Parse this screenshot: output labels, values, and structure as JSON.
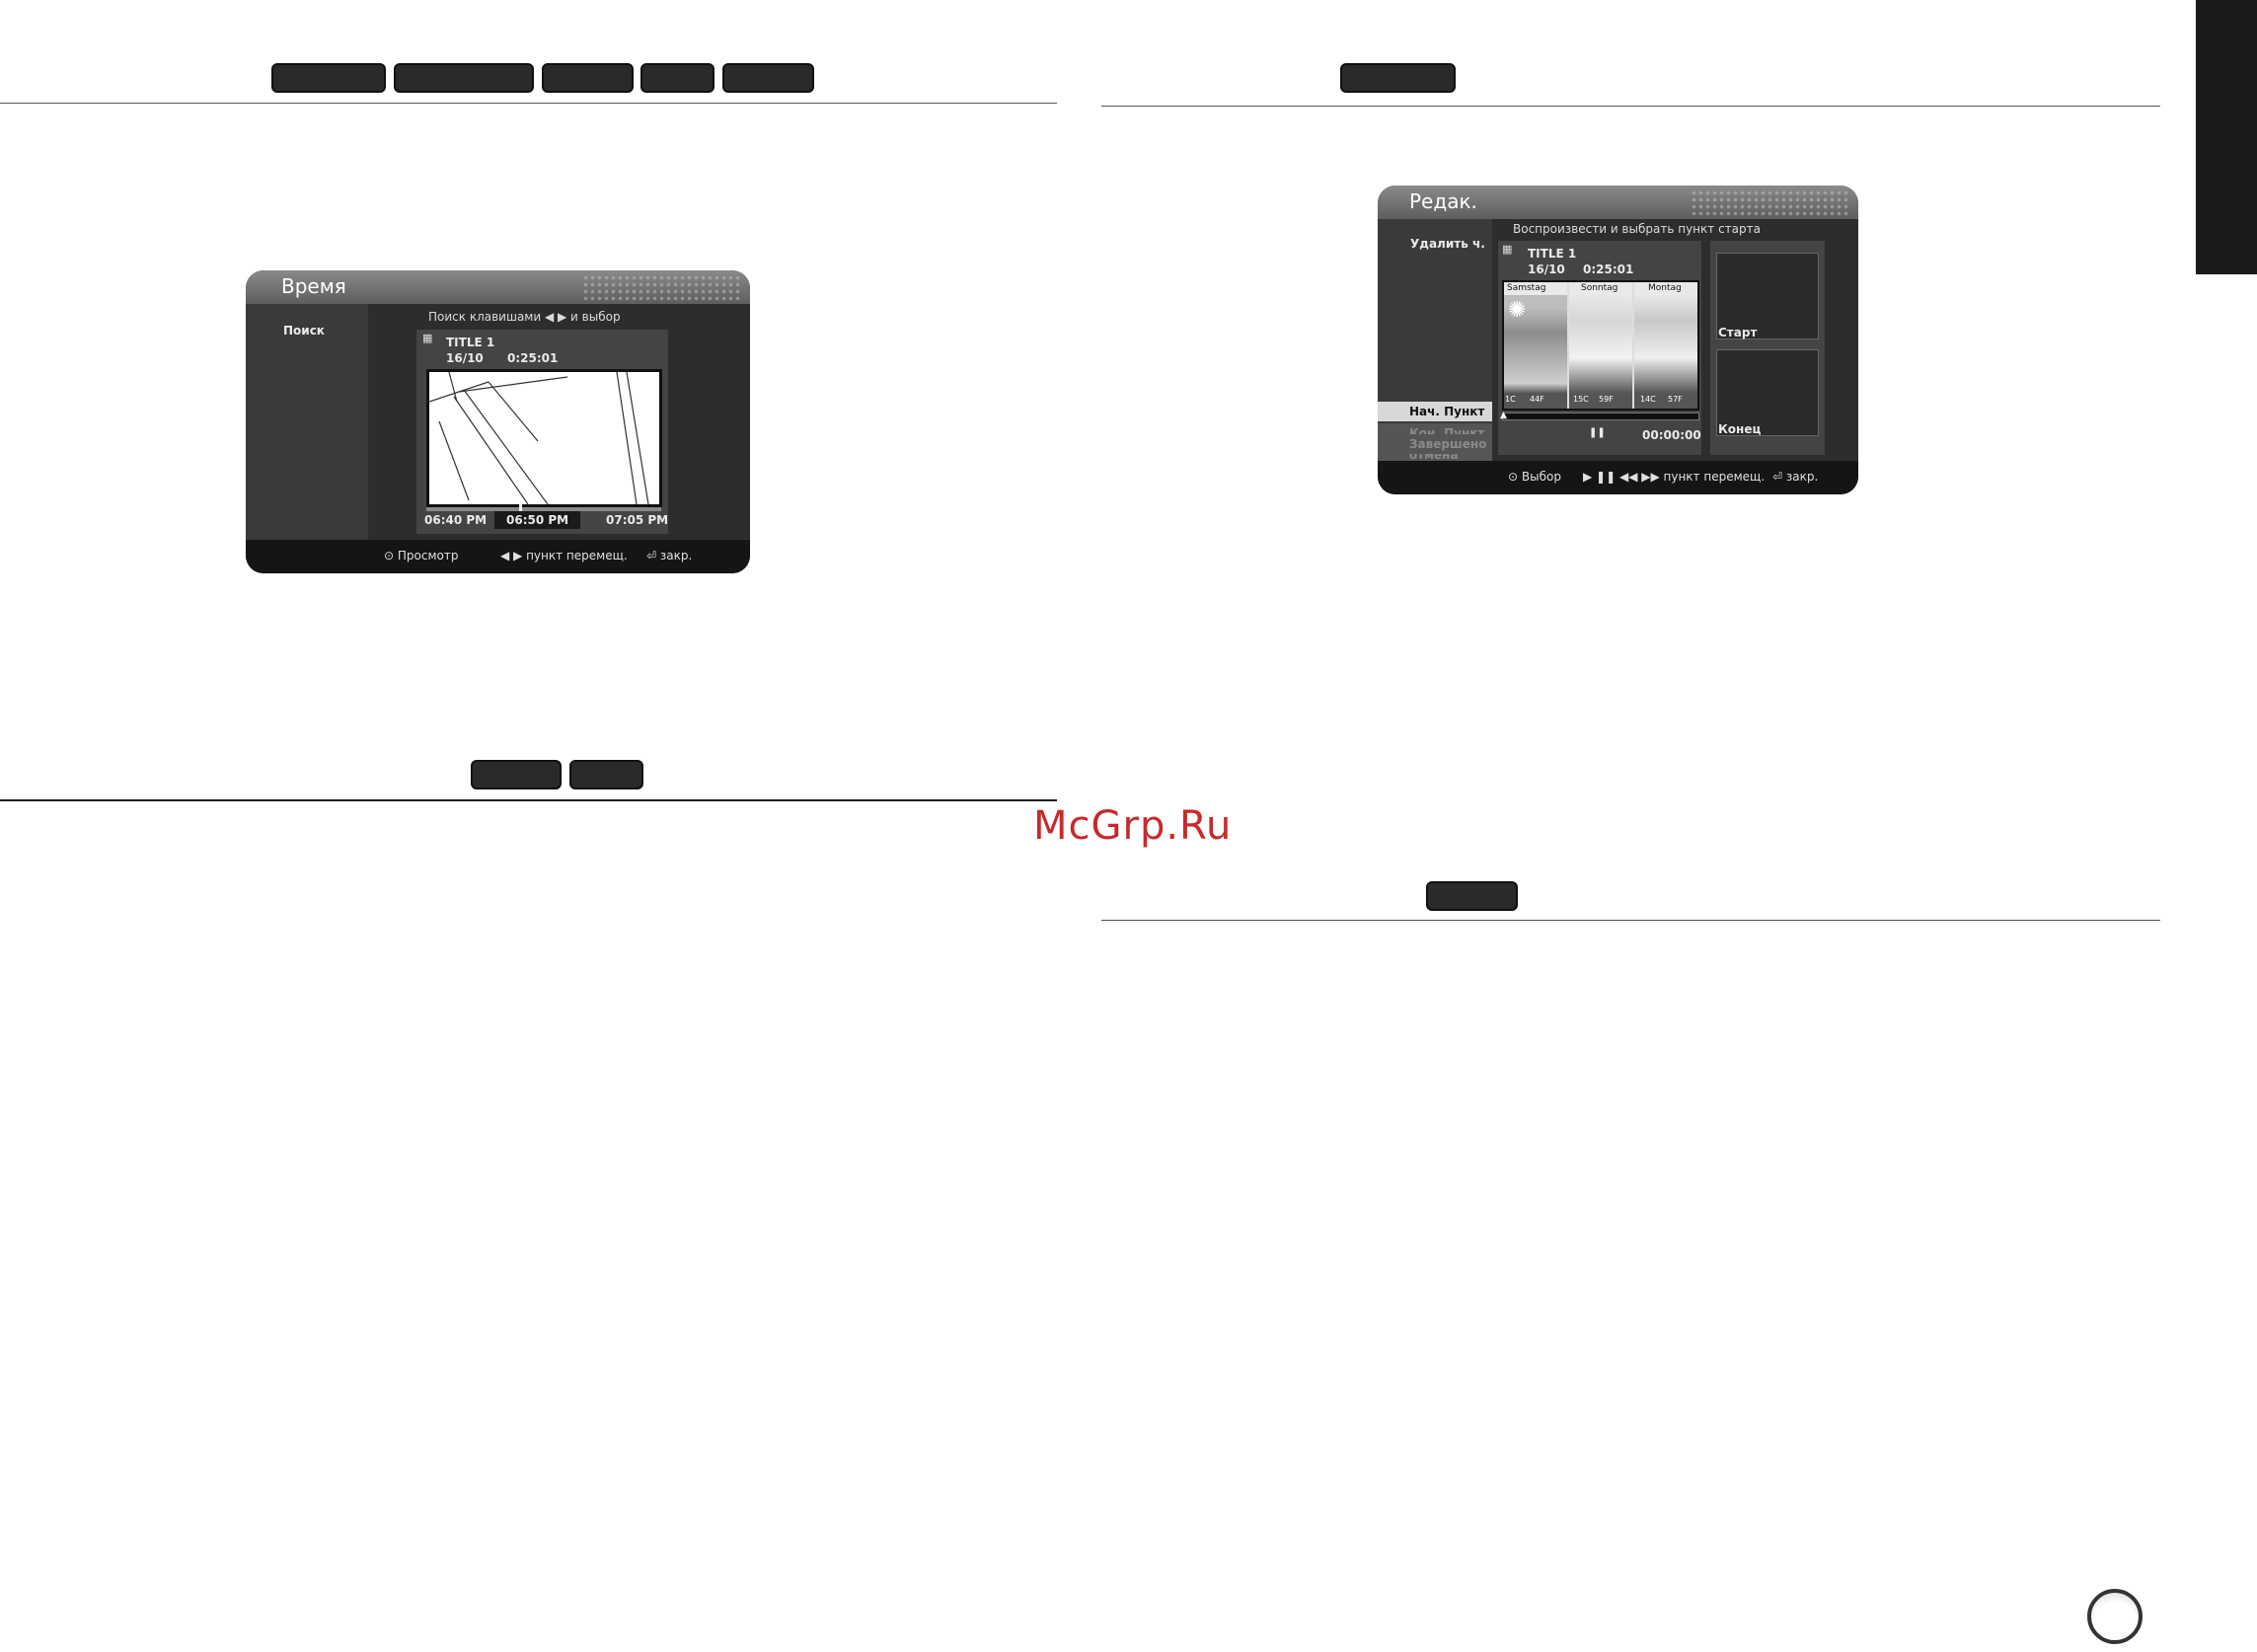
{
  "watermark": "McGrp.Ru",
  "left_top_badges": 5,
  "osd_time": {
    "title": "Время",
    "menu_item": "Поиск",
    "hint": "Поиск клавишами ◀ ▶ и выбор",
    "title_name": "TITLE 1",
    "date": "16/10",
    "duration": "0:25:01",
    "times": [
      "06:40 PM",
      "06:50 PM",
      "07:05 PM"
    ],
    "footer": {
      "play": "⊙ Просмотр",
      "move": "◀ ▶ пункт перемещ.",
      "close": "⏎ закр."
    }
  },
  "osd_edit": {
    "title": "Редак.",
    "menu_head": "Удалить ч.",
    "menu_items": [
      "Нач. Пункт",
      "Кон. Пункт",
      "отмена",
      "Завершено"
    ],
    "hint": "Воспроизвести и выбрать пункт старта",
    "title_name": "TITLE 1",
    "date": "16/10",
    "duration": "0:25:01",
    "days": [
      "Samstag",
      "Sonntag",
      "Montag"
    ],
    "temps": [
      "1C",
      "44F",
      "15C",
      "59F",
      "14C",
      "57F"
    ],
    "pause_icon": "❚❚",
    "timecode": "00:00:00",
    "start_label": "Старт",
    "end_label": "Конец",
    "footer": {
      "select": "⊙ Выбор",
      "move": "▶ ❚❚ ◀◀ ▶▶ пункт перемещ.",
      "close": "⏎ закр."
    }
  }
}
